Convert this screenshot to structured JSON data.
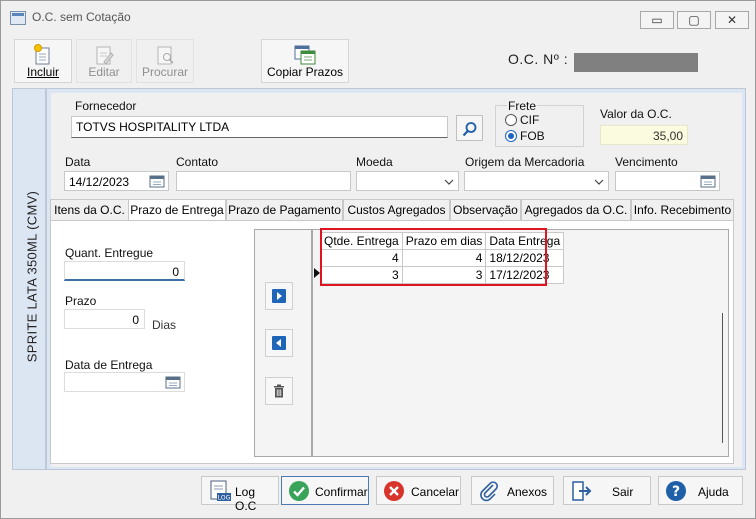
{
  "window": {
    "title": "O.C. sem Cotação",
    "controls": {
      "minimize": "▭",
      "maximize": "▢",
      "close": "✕"
    }
  },
  "toolbar": {
    "incluir": "Incluir",
    "editar": "Editar",
    "procurar": "Procurar",
    "copiar_prazos": "Copiar Prazos",
    "oc_label": "O.C. Nº :"
  },
  "side": {
    "product": "SPRITE LATA 350ML (CMV)"
  },
  "form": {
    "fornecedor_label": "Fornecedor",
    "fornecedor_value": "TOTVS HOSPITALITY LTDA",
    "frete_label": "Frete",
    "frete_options": [
      "CIF",
      "FOB"
    ],
    "frete_selected": "FOB",
    "valor_label": "Valor da O.C.",
    "valor_value": "35,00",
    "data_label": "Data",
    "data_value": "14/12/2023",
    "contato_label": "Contato",
    "contato_value": "",
    "moeda_label": "Moeda",
    "origem_label": "Origem da Mercadoria",
    "vencimento_label": "Vencimento"
  },
  "tabs": [
    {
      "label": "Itens da O.C.",
      "active": false
    },
    {
      "label": "Prazo de Entrega",
      "active": true
    },
    {
      "label": "Prazo de Pagamento",
      "active": false
    },
    {
      "label": "Custos Agregados",
      "active": false
    },
    {
      "label": "Observação",
      "active": false
    },
    {
      "label": "Agregados da O.C.",
      "active": false
    },
    {
      "label": "Info. Recebimento",
      "active": false
    }
  ],
  "prazo_tab": {
    "quant_label": "Quant. Entregue",
    "quant_value": "0",
    "prazo_label": "Prazo",
    "prazo_value": "0",
    "dias_label": "Dias",
    "data_entrega_label": "Data de Entrega"
  },
  "grid": {
    "columns": [
      "Qtde. Entrega",
      "Prazo em dias",
      "Data Entrega"
    ],
    "rows": [
      [
        "4",
        "4",
        "18/12/2023"
      ],
      [
        "3",
        "3",
        "17/12/2023"
      ]
    ],
    "current_row": 1
  },
  "footer": {
    "log": "Log O.C",
    "confirmar": "Confirmar",
    "cancelar": "Cancelar",
    "anexos": "Anexos",
    "sair": "Sair",
    "ajuda": "Ajuda"
  }
}
